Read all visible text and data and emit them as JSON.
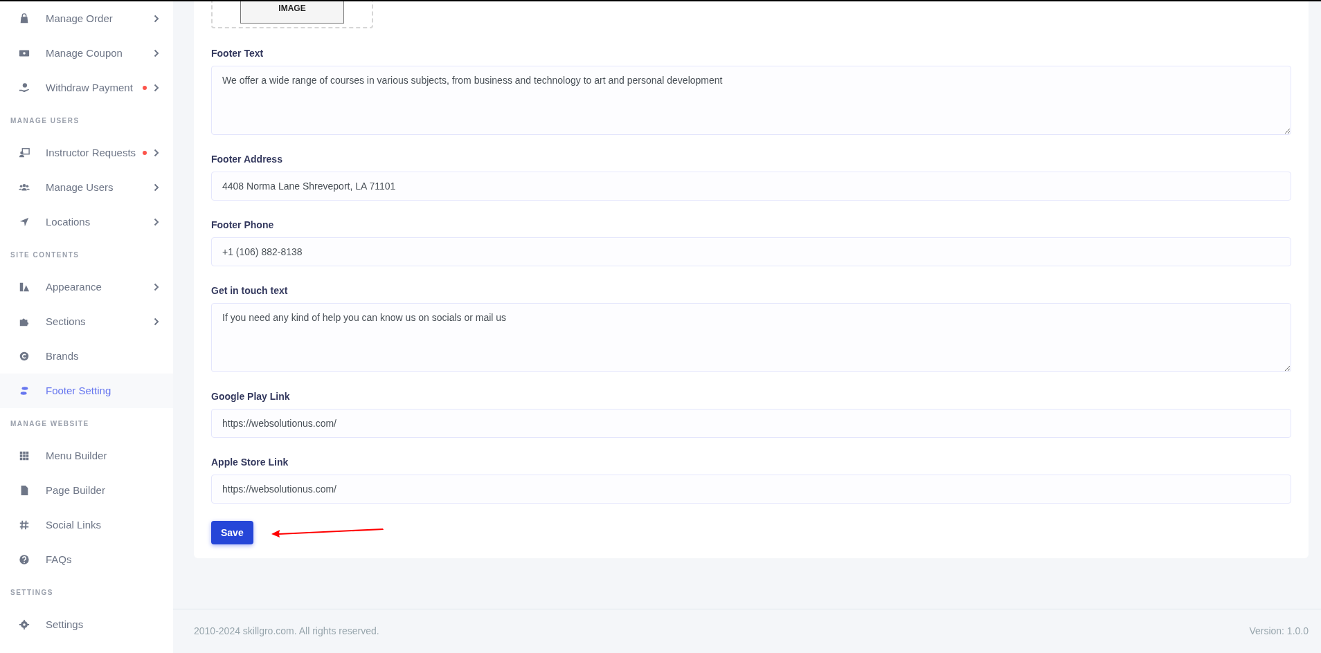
{
  "sidebar": {
    "groups": [
      {
        "items": [
          {
            "label": "Manage Order",
            "selected": false,
            "submenu": true,
            "alert": false
          },
          {
            "label": "Manage Coupon",
            "selected": false,
            "submenu": true,
            "alert": false
          },
          {
            "label": "Withdraw Payment",
            "selected": false,
            "submenu": true,
            "alert": true
          }
        ]
      },
      {
        "heading": "MANAGE USERS",
        "items": [
          {
            "label": "Instructor Requests",
            "selected": false,
            "submenu": true,
            "alert": true
          },
          {
            "label": "Manage Users",
            "selected": false,
            "submenu": true,
            "alert": false
          },
          {
            "label": "Locations",
            "selected": false,
            "submenu": true,
            "alert": false
          }
        ]
      },
      {
        "heading": "SITE CONTENTS",
        "items": [
          {
            "label": "Appearance",
            "selected": false,
            "submenu": true,
            "alert": false
          },
          {
            "label": "Sections",
            "selected": false,
            "submenu": true,
            "alert": false
          },
          {
            "label": "Brands",
            "selected": false,
            "submenu": false,
            "alert": false
          },
          {
            "label": "Footer Setting",
            "selected": true,
            "submenu": false,
            "alert": false
          }
        ]
      },
      {
        "heading": "MANAGE WEBSITE",
        "items": [
          {
            "label": "Menu Builder",
            "selected": false,
            "submenu": false,
            "alert": false
          },
          {
            "label": "Page Builder",
            "selected": false,
            "submenu": false,
            "alert": false
          },
          {
            "label": "Social Links",
            "selected": false,
            "submenu": false,
            "alert": false
          },
          {
            "label": "FAQs",
            "selected": false,
            "submenu": false,
            "alert": false
          }
        ]
      },
      {
        "heading": "SETTINGS",
        "items": [
          {
            "label": "Settings",
            "selected": false,
            "submenu": false,
            "alert": false
          }
        ]
      }
    ]
  },
  "form": {
    "image_preview": {
      "label": "IMAGE"
    },
    "fields": [
      {
        "kind": "textarea",
        "label": "Footer Text",
        "value": "We offer a wide range of courses in various subjects, from business and technology to art and personal development"
      },
      {
        "kind": "input",
        "label": "Footer Address",
        "value": "4408 Norma Lane Shreveport, LA 71101"
      },
      {
        "kind": "input",
        "label": "Footer Phone",
        "value": "+1 (106) 882-8138"
      },
      {
        "kind": "textarea",
        "label": "Get in touch text",
        "value": "If you need any kind of help you can know us on socials or mail us"
      },
      {
        "kind": "input",
        "label": "Google Play Link",
        "value": "https://websolutionus.com/"
      },
      {
        "kind": "input",
        "label": "Apple Store Link",
        "value": "https://websolutionus.com/"
      }
    ],
    "save_button": "Save"
  },
  "footer": {
    "copyright": "2010-2024 skillgro.com. All rights reserved.",
    "version": "Version: 1.0.0"
  }
}
